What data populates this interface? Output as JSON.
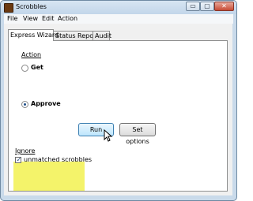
{
  "window": {
    "title": "Scrobbles",
    "minimize_glyph": "▭",
    "maximize_glyph": "▢",
    "close_glyph": "✕"
  },
  "menu": {
    "items": [
      "File",
      "View",
      "Edit",
      "Action"
    ]
  },
  "tabs": [
    {
      "label": "Express Wizard",
      "active": true
    },
    {
      "label": "Status Report",
      "active": false
    },
    {
      "label": "Audit",
      "active": false
    }
  ],
  "action_group": {
    "label": "Action",
    "options": [
      {
        "label": "Get",
        "selected": false
      },
      {
        "label": "Approve",
        "selected": true
      }
    ]
  },
  "buttons": {
    "run_label": "Run",
    "set_options_label": "Set options"
  },
  "ignore_group": {
    "label": "Ignore",
    "checkbox_label": "unmatched scrobbles",
    "checkbox_checked": true,
    "checkmark": "✓"
  },
  "colors": {
    "highlight": "#f4f36a",
    "default_button_border": "#3c7fb1"
  }
}
